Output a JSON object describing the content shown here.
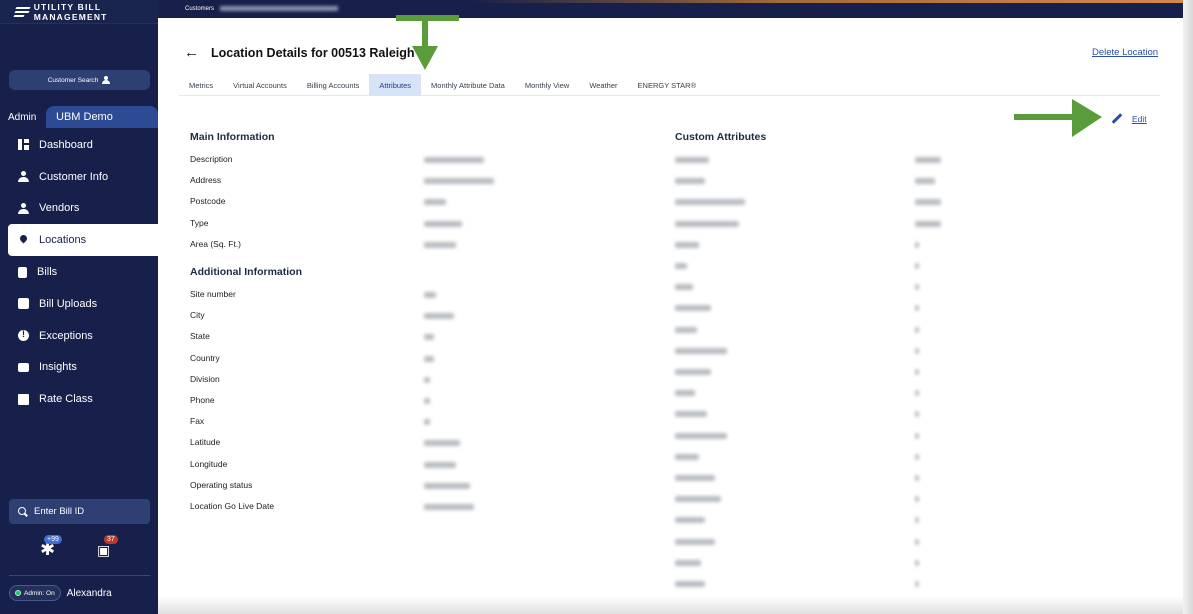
{
  "brand": {
    "name": "UTILITY BILL MANAGEMENT"
  },
  "sidebar": {
    "customer_search": "Customer Search",
    "admin_label": "Admin",
    "org_name": "UBM Demo",
    "items": [
      {
        "label": "Dashboard",
        "icon": "dashboard-icon"
      },
      {
        "label": "Customer Info",
        "icon": "person-icon"
      },
      {
        "label": "Vendors",
        "icon": "person-icon"
      },
      {
        "label": "Locations",
        "icon": "location-pin-icon",
        "active": true
      },
      {
        "label": "Bills",
        "icon": "document-icon"
      },
      {
        "label": "Bill Uploads",
        "icon": "upload-icon"
      },
      {
        "label": "Exceptions",
        "icon": "exclamation-icon"
      },
      {
        "label": "Insights",
        "icon": "message-icon"
      },
      {
        "label": "Rate Class",
        "icon": "chart-icon"
      }
    ],
    "bill_id_placeholder": "Enter Bill ID",
    "notification_count": "+99",
    "bill_badge_count": "37",
    "admin_toggle": "Admin: On",
    "user_name": "Alexandra"
  },
  "breadcrumb": {
    "root": "Customers"
  },
  "page": {
    "title": "Location Details for 00513 Raleigh",
    "delete_label": "Delete Location",
    "edit_label": "Edit"
  },
  "tabs": [
    {
      "label": "Metrics"
    },
    {
      "label": "Virtual Accounts"
    },
    {
      "label": "Billing Accounts"
    },
    {
      "label": "Attributes",
      "active": true
    },
    {
      "label": "Monthly Attribute Data"
    },
    {
      "label": "Monthly View"
    },
    {
      "label": "Weather"
    },
    {
      "label": "ENERGY STAR®"
    }
  ],
  "main_info": {
    "title": "Main Information",
    "fields": [
      "Description",
      "Address",
      "Postcode",
      "Type",
      "Area (Sq. Ft.)"
    ]
  },
  "additional_info": {
    "title": "Additional Information",
    "fields": [
      "Site number",
      "City",
      "State",
      "Country",
      "Division",
      "Phone",
      "Fax",
      "Latitude",
      "Longitude",
      "Operating status",
      "Location Go Live Date"
    ]
  },
  "custom_attributes": {
    "title": "Custom Attributes"
  },
  "colors": {
    "sidebar": "#17204a",
    "accent": "#2b4ea8",
    "tab_active": "#d7e3f7",
    "arrow": "#5a9b3a"
  }
}
